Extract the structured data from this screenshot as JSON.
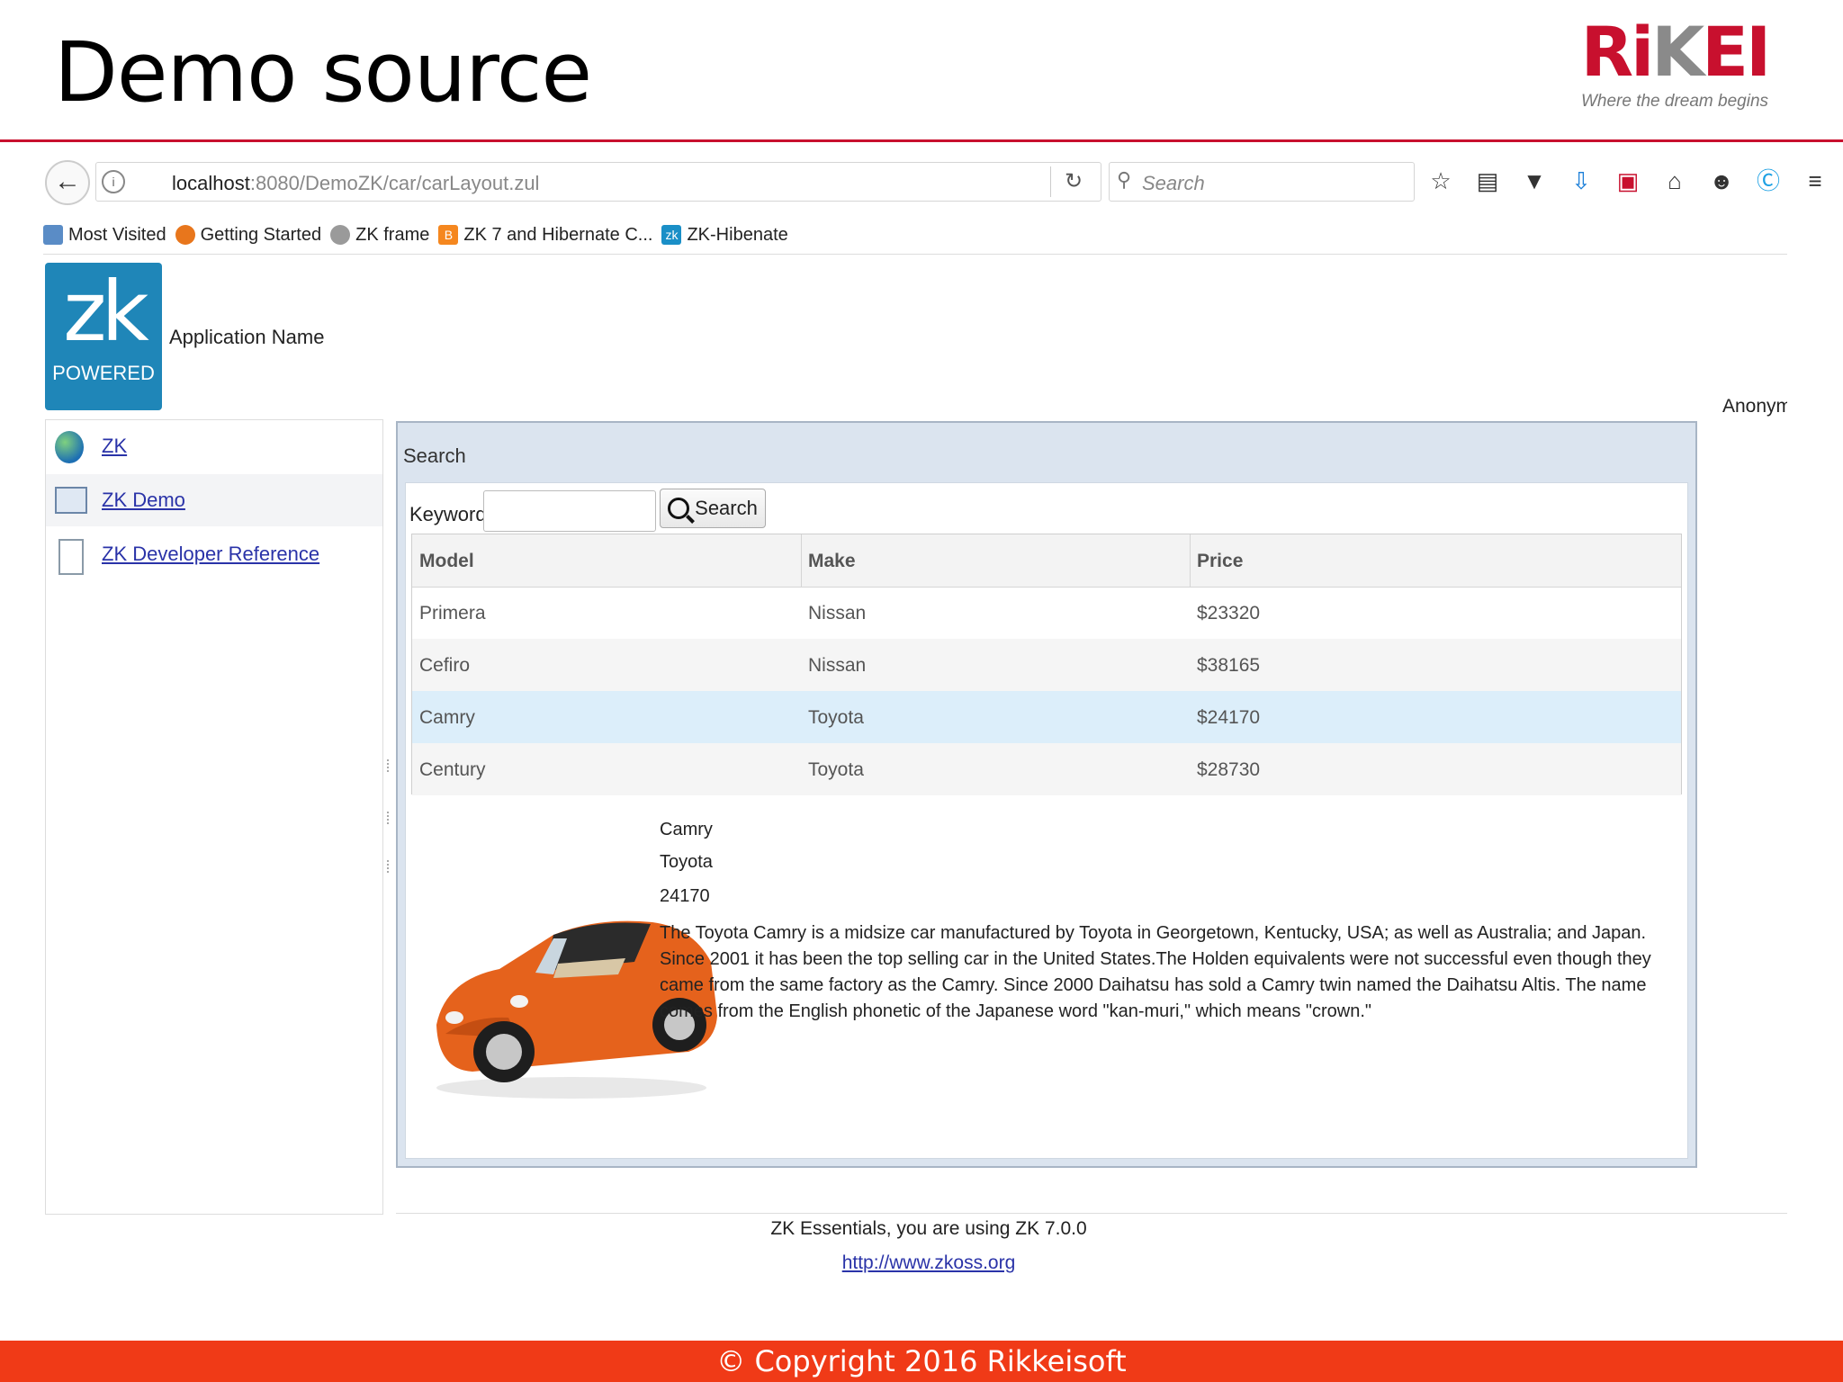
{
  "slide": {
    "title": "Demo source",
    "brand": {
      "word_red": "Ri",
      "word_grey": "K",
      "word_red2": "EI",
      "tagline": "Where the dream begins"
    },
    "copyright": "© Copyright 2016 Rikkeisoft"
  },
  "browser": {
    "url_host": "localhost",
    "url_path": ":8080/DemoZK/car/carLayout.zul",
    "search_placeholder": "Search",
    "bookmarks": [
      {
        "label": "Most Visited",
        "icon": "most-visited-icon"
      },
      {
        "label": "Getting Started",
        "icon": "firefox-icon"
      },
      {
        "label": "ZK frame",
        "icon": "globe-icon"
      },
      {
        "label": "ZK 7 and Hibernate C...",
        "icon": "blogger-icon"
      },
      {
        "label": "ZK-Hibenate",
        "icon": "zk-icon"
      }
    ]
  },
  "app": {
    "logo_mark": "zk",
    "logo_sub": "POWERED",
    "name": "Application Name",
    "user": "Anonymous",
    "sidebar": [
      {
        "label": "ZK",
        "icon": "globe-icon"
      },
      {
        "label": "ZK Demo",
        "icon": "monitor-icon"
      },
      {
        "label": "ZK Developer Reference",
        "icon": "document-icon"
      }
    ],
    "panel_title": "Search",
    "keyword_label": "Keyword:",
    "keyword_value": "",
    "search_button": "Search",
    "columns": [
      "Model",
      "Make",
      "Price"
    ],
    "rows": [
      {
        "model": "Primera",
        "make": "Nissan",
        "price": "$23320"
      },
      {
        "model": "Cefiro",
        "make": "Nissan",
        "price": "$38165"
      },
      {
        "model": "Camry",
        "make": "Toyota",
        "price": "$24170"
      },
      {
        "model": "Century",
        "make": "Toyota",
        "price": "$28730"
      }
    ],
    "selected_row": 2,
    "detail": {
      "model": "Camry",
      "make": "Toyota",
      "price": "24170",
      "description": "The Toyota Camry is a midsize car manufactured by Toyota in Georgetown, Kentucky, USA; as well as Australia; and Japan. Since 2001 it has been the top selling car in the United States.The Holden equivalents were not successful even though they came from the same factory as the Camry. Since 2000 Daihatsu has sold a Camry twin named the Daihatsu Altis. The name comes from the English phonetic of the Japanese word \"kan-muri,\" which means \"crown.\""
    },
    "footer_text": "ZK Essentials, you are using ZK 7.0.0",
    "footer_link": "http://www.zkoss.org"
  },
  "colors": {
    "brand_red": "#c8102e",
    "copyright_bar": "#f03a17",
    "zk_blue": "#1f86b8",
    "selected_row": "#dceefa"
  }
}
